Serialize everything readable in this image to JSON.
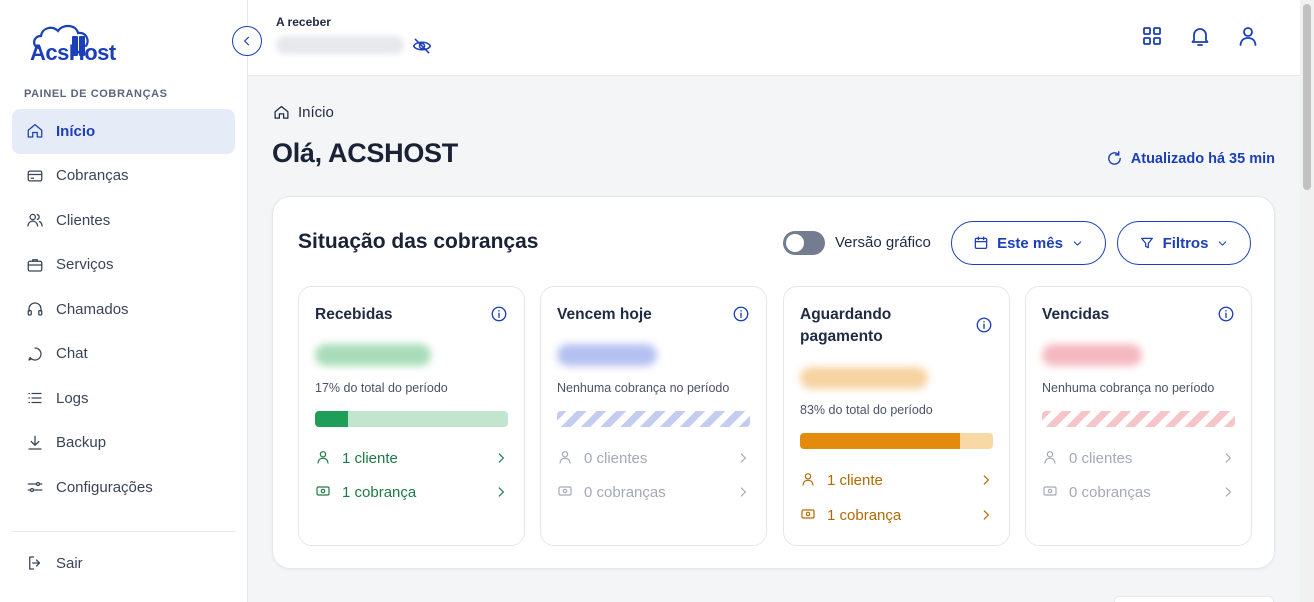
{
  "brand": {
    "logo_text": "AcsHost"
  },
  "sidebar": {
    "section_label": "PAINEL DE COBRANÇAS",
    "items": [
      {
        "label": "Início",
        "icon": "home-icon",
        "active": true
      },
      {
        "label": "Cobranças",
        "icon": "card-icon"
      },
      {
        "label": "Clientes",
        "icon": "users-icon"
      },
      {
        "label": "Serviços",
        "icon": "briefcase-icon"
      },
      {
        "label": "Chamados",
        "icon": "headset-icon"
      },
      {
        "label": "Chat",
        "icon": "chat-icon"
      },
      {
        "label": "Logs",
        "icon": "list-icon"
      },
      {
        "label": "Backup",
        "icon": "download-icon"
      },
      {
        "label": "Configurações",
        "icon": "sliders-icon"
      }
    ],
    "logout_label": "Sair"
  },
  "topbar": {
    "receive_label": "A receber",
    "icons": [
      "apps-grid-icon",
      "bell-icon",
      "user-icon"
    ]
  },
  "breadcrumb": {
    "label": "Início"
  },
  "greeting": "Olá, ACSHOST",
  "updated_label": "Atualizado há 35 min",
  "panel": {
    "title": "Situação das cobranças",
    "toggle_label": "Versão gráfico",
    "toggle_on": false,
    "period_button": "Este mês",
    "filter_button": "Filtros"
  },
  "cards": [
    {
      "title": "Recebidas",
      "note": "17% do total do período",
      "progress_percent": 17,
      "clients_label": "1 cliente",
      "charges_label": "1 cobrança",
      "color": "#1f9e5a",
      "track_color": "#c2e5cf"
    },
    {
      "title": "Vencem hoje",
      "note": "Nenhuma cobrança no período",
      "progress_percent": 0,
      "clients_label": "0 clientes",
      "charges_label": "0 cobranças",
      "color": "#c4cdf0"
    },
    {
      "title": "Aguardando pagamento",
      "note": "83% do total do período",
      "progress_percent": 83,
      "clients_label": "1 cliente",
      "charges_label": "1 cobrança",
      "color": "#e38b0c",
      "track_color": "#f8d9a6"
    },
    {
      "title": "Vencidas",
      "note": "Nenhuma cobrança no período",
      "progress_percent": 0,
      "clients_label": "0 clientes",
      "charges_label": "0 cobranças",
      "color": "#f6c5c9"
    }
  ],
  "colors": {
    "accent": "#1b3fb8",
    "green": "#1f9e5a",
    "orange": "#e38b0c",
    "red": "#e66a73"
  }
}
